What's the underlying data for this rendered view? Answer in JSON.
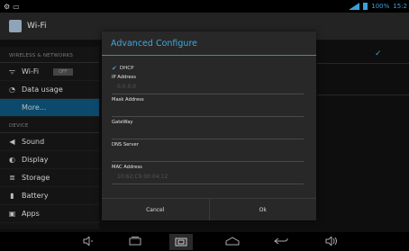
{
  "status_bar": {
    "time": "15:2",
    "battery_text": "100%"
  },
  "action_bar": {
    "title": "Wi-Fi"
  },
  "sidebar": {
    "sections": [
      {
        "header": "WIRELESS & NETWORKS",
        "items": [
          {
            "label": "Wi-Fi",
            "icon": "wifi-icon",
            "toggle": "OFF"
          },
          {
            "label": "Data usage",
            "icon": "data-usage-icon"
          },
          {
            "label": "More...",
            "icon": ""
          }
        ]
      },
      {
        "header": "DEVICE",
        "items": [
          {
            "label": "Sound",
            "icon": "speaker-icon"
          },
          {
            "label": "Display",
            "icon": "display-icon"
          },
          {
            "label": "Storage",
            "icon": "storage-icon"
          },
          {
            "label": "Battery",
            "icon": "battery-icon"
          },
          {
            "label": "Apps",
            "icon": "apps-icon"
          }
        ]
      }
    ]
  },
  "dialog": {
    "title": "Advanced Configure",
    "dhcp_label": "DHCP",
    "dhcp_checked": true,
    "fields": [
      {
        "label": "IP Address",
        "value": "0.0.0.0"
      },
      {
        "label": "Mask Address",
        "value": ""
      },
      {
        "label": "GateWay",
        "value": ""
      },
      {
        "label": "DNS Server",
        "value": ""
      },
      {
        "label": "MAC Address",
        "value": "10:62:C9:00:04:12"
      }
    ],
    "cancel_label": "Cancel",
    "ok_label": "Ok"
  },
  "nav_bar": {
    "buttons": [
      "volume-down-icon",
      "recent-apps-icon",
      "screenshot-icon",
      "home-icon",
      "back-icon",
      "volume-up-icon"
    ]
  },
  "colors": {
    "accent": "#3aa0d8",
    "dialog_bg": "#282828",
    "selected_item": "#0b4a6d"
  }
}
